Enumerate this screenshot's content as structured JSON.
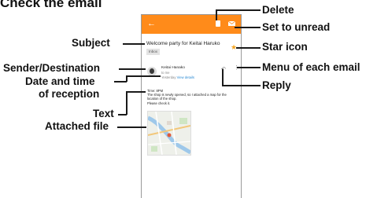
{
  "heading": "Check the email",
  "callouts": {
    "delete": "Delete",
    "set_unread": "Set to unread",
    "subject": "Subject",
    "star": "Star icon",
    "sender": "Sender/Destination",
    "menu": "Menu of each email",
    "date_line1": "Date and time",
    "date_line2": "of reception",
    "reply": "Reply",
    "text": "Text",
    "attached": "Attached file"
  },
  "email": {
    "subject": "Welcome party for Keitai Haruko",
    "folder_chip": "Inbox",
    "sender_name": "Keitai Hanako",
    "recipient": "to me",
    "date": "Yesterday",
    "details_link": "View details",
    "body": [
      "Time: 8PM",
      "The shop is newly opened, so I attached a map for the",
      "location of the shop.",
      "Please check it."
    ]
  },
  "colors": {
    "app_bar": "#ff8b1a",
    "star": "#f5a623",
    "link": "#2a8ad4"
  },
  "icons": [
    "back-arrow-icon",
    "trash-icon",
    "mail-icon",
    "star-icon",
    "reply-icon",
    "more-vert-icon"
  ]
}
